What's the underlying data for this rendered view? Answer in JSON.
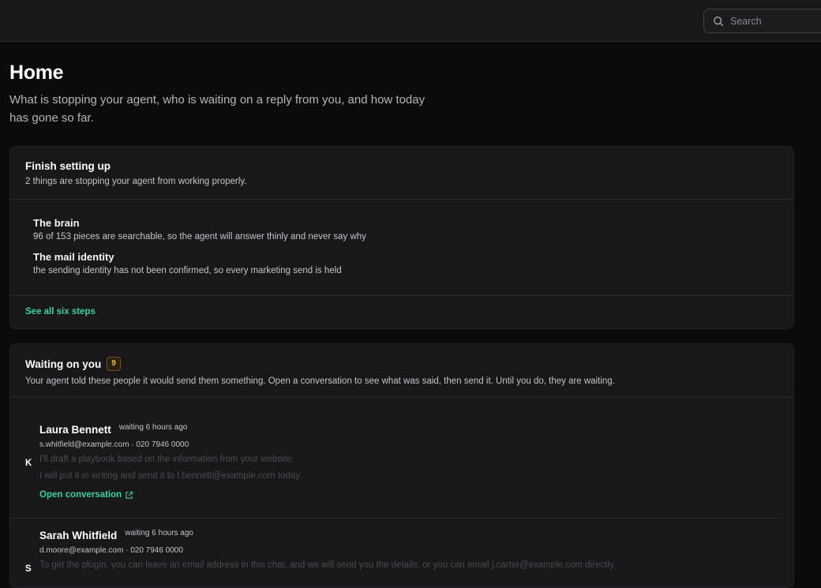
{
  "search": {
    "placeholder": "Search",
    "icon": "search-icon"
  },
  "page": {
    "title": "Home",
    "subtitle": "What is stopping your agent, who is waiting on a reply from you, and how today has gone so far."
  },
  "setup": {
    "title": "Finish setting up",
    "description": "2 things are stopping your agent from working properly.",
    "items": [
      {
        "name": "The brain",
        "detail": "96 of 153 pieces are searchable, so the agent will answer thinly and never say why"
      },
      {
        "name": "The mail identity",
        "detail": "the sending identity has not been confirmed, so every marketing send is held"
      }
    ],
    "see_all_label": "See all six steps"
  },
  "waiting": {
    "title": "Waiting on you",
    "count": "9",
    "description": "Your agent told these people it would send them something. Open a conversation to see what was said, then send it. Until you do, they are waiting.",
    "conversations": [
      {
        "avatar_initial": "K",
        "name": "Laura Bennett",
        "waiting_time": "waiting 6 hours ago",
        "contact": "s.whitfield@example.com · 020 7946 0000",
        "messages": [
          "I'll draft a playbook based on the information from your website.",
          "I will put it in writing and send it to l.bennett@example.com today."
        ],
        "open_label": "Open conversation"
      },
      {
        "avatar_initial": "S",
        "name": "Sarah Whitfield",
        "waiting_time": "waiting 6 hours ago",
        "contact": "d.moore@example.com · 020 7946 0000",
        "messages": [
          "To get the plugin, you can leave an email address in this chat, and we will send you the details, or you can email j.carter@example.com directly."
        ]
      }
    ]
  },
  "colors": {
    "accent": "#34d399",
    "badge": "#fbbf24",
    "background": "#0b0b0d",
    "card": "#18181b"
  }
}
